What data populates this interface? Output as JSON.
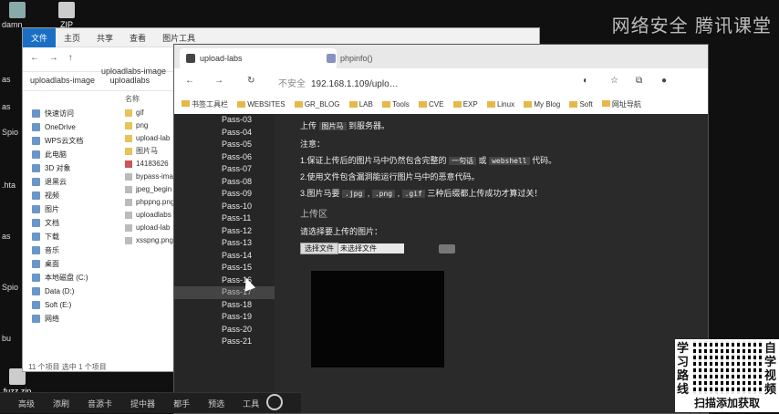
{
  "desktop": {
    "icons": [
      {
        "label": ""
      },
      {
        "label": "ZIP"
      },
      {
        "label": "damn"
      }
    ],
    "left_labels": [
      "as",
      "as",
      "Spio",
      ".hta",
      "as",
      "Spio",
      "bu",
      "fuzz.zip"
    ],
    "watermark": "网络安全 腾讯课堂",
    "taskbar": [
      "高级",
      "添刷",
      "音源卡",
      "提中器",
      "都手",
      "预选",
      "工具"
    ]
  },
  "explorer": {
    "ribbon_tabs": [
      "文件",
      "主页",
      "共享",
      "查看",
      "图片工具"
    ],
    "nav_path": "uploadlabs-image",
    "breadcrumb": [
      "uploadlabs-image",
      "uploadlabs"
    ],
    "name_header": "名称",
    "sidebar": [
      "快速访问",
      "OneDrive",
      "WPS云文档",
      "此电脑",
      "3D 对象",
      "退黑云",
      "视频",
      "图片",
      "文档",
      "下载",
      "音乐",
      "桌面",
      "本地磁盘 (C:)",
      "Data (D:)",
      "Soft (E:)",
      "网络"
    ],
    "files": [
      "gif",
      "png",
      "upload-lab",
      "图片马",
      "14183626",
      "bypass-ima",
      "jpeg_begin",
      "phppng.png",
      "uploadlabs",
      "upload-lab",
      "xsspng.png"
    ],
    "status": "11 个项目    选中 1 个项目"
  },
  "browser": {
    "tab_active": "upload-labs",
    "tab_other": "phpinfo()",
    "url_warning": "不安全",
    "url": "192.168.1.109/uplo…",
    "bookmarks": [
      "书签工具栏",
      "WEBSITES",
      "GR_BLOG",
      "LAB",
      "Tools",
      "CVE",
      "EXP",
      "Linux",
      "My Blog",
      "Soft",
      "网址导航"
    ],
    "passes": [
      "Pass-03",
      "Pass-04",
      "Pass-05",
      "Pass-06",
      "Pass-07",
      "Pass-08",
      "Pass-09",
      "Pass-10",
      "Pass-11",
      "Pass-12",
      "Pass-13",
      "Pass-14",
      "Pass-15",
      "Pass-16",
      "Pass-17",
      "Pass-18",
      "Pass-19",
      "Pass-20",
      "Pass-21"
    ],
    "main": {
      "line1_pre": "上传",
      "line1_code": "图片马",
      "line1_post": "到服务器。",
      "note": "注意：",
      "item1_pre": "1.保证上传后的图片马中仍然包含完整的",
      "item1_code1": "一句话",
      "item1_mid": "或",
      "item1_code2": "webshell",
      "item1_post": "代码。",
      "item2": "2.使用文件包含漏洞能运行图片马中的恶意代码。",
      "item3_pre": "3.图片马要",
      "item3_c1": ".jpg",
      "item3_c2": ".png",
      "item3_c3": ".gif",
      "item3_post": "三种后缀都上传成功才算过关！",
      "section": "上传区",
      "select_label": "请选择要上传的图片：",
      "choose_btn": "选择文件",
      "no_file": "未选择文件"
    }
  },
  "banner": {
    "left": "学习路线",
    "right": "自学视频",
    "bottom": "扫描添加获取"
  }
}
